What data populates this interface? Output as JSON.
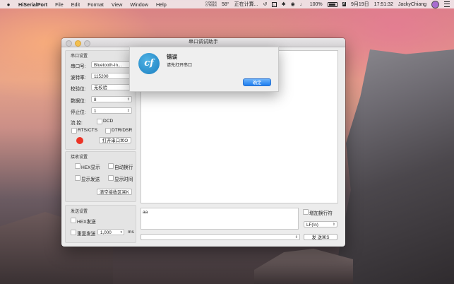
{
  "menubar": {
    "apple": "",
    "app_name": "HiSerialPort",
    "items": [
      "File",
      "Edit",
      "Format",
      "View",
      "Window",
      "Help"
    ],
    "status": {
      "net_up": "0.0KB/s",
      "net_down": "0.7KB/s",
      "temperature": "58°",
      "computing": "正在计算...",
      "battery_percent": "100%",
      "date": "9月19日",
      "time": "17:51:32",
      "user": "JackyChiang"
    }
  },
  "window": {
    "title": "串口调试助手",
    "serial_settings": {
      "section": "串口设置",
      "port_label": "串口号:",
      "port_value": "Bluetooth-In...",
      "baud_label": "波特率:",
      "baud_value": "115200",
      "parity_label": "校验位:",
      "parity_value": "无校验",
      "databits_label": "数据位:",
      "databits_value": "8",
      "stopbits_label": "停止位:",
      "stopbits_value": "1",
      "flow_label": "流  控:",
      "dcd": "DCD",
      "rts_cts": "RTS/CTS",
      "dtr_dsr": "DTR/DSR",
      "open_button": "打开串口⌘O"
    },
    "receive_settings": {
      "section": "接收设置",
      "hex_display": "HEX显示",
      "auto_wrap": "自动换行",
      "show_send": "显示发送",
      "show_time": "显示时间",
      "clear_button": "清空接收区⌘K"
    },
    "send_settings": {
      "section": "发送设置",
      "hex_send": "HEX发送",
      "repeat_send": "重复发送",
      "repeat_value": "1,000",
      "ms": "ms",
      "send_text": "aa",
      "add_newline": "增加换行符",
      "newline_value": "LF(\\n)",
      "send_button": "发    送⌘S"
    }
  },
  "alert": {
    "title": "错误",
    "message": "请先打开串口",
    "ok_button": "确定",
    "icon_glyph": "cf"
  },
  "colors": {
    "accent": "#1e7ef0",
    "status_dot": "#ec3426"
  }
}
